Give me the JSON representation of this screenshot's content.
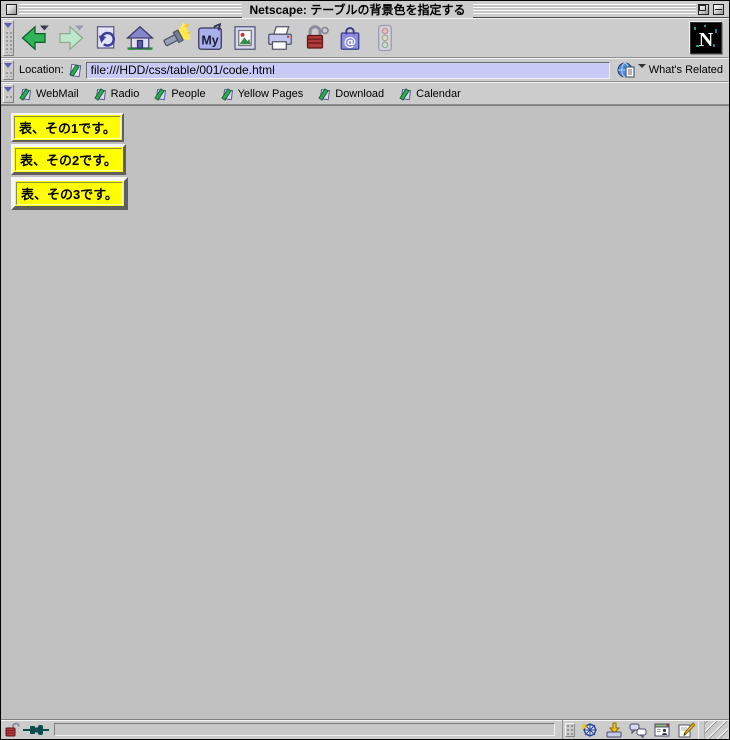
{
  "window": {
    "title": "Netscape: テーブルの背景色を指定する",
    "controls": [
      "close",
      "zoom",
      "collapse"
    ]
  },
  "toolbar": {
    "buttons": [
      {
        "name": "Back",
        "icon": "back-arrow-icon",
        "enabled": true
      },
      {
        "name": "Forward",
        "icon": "forward-arrow-icon",
        "enabled": false
      },
      {
        "name": "Reload",
        "icon": "reload-icon",
        "enabled": true
      },
      {
        "name": "Home",
        "icon": "home-icon",
        "enabled": true
      },
      {
        "name": "Search",
        "icon": "flashlight-icon",
        "enabled": true
      },
      {
        "name": "My Netscape",
        "icon": "my-netscape-icon",
        "enabled": true
      },
      {
        "name": "Images",
        "icon": "images-icon",
        "enabled": true
      },
      {
        "name": "Print",
        "icon": "printer-icon",
        "enabled": true
      },
      {
        "name": "Security",
        "icon": "padlock-icon",
        "enabled": true
      },
      {
        "name": "Shop",
        "icon": "shopping-bag-icon",
        "enabled": true
      },
      {
        "name": "Stop",
        "icon": "traffic-light-icon",
        "enabled": false
      }
    ],
    "throbber": {
      "name": "Netscape N logo",
      "letter": "N"
    }
  },
  "location_bar": {
    "label": "Location:",
    "value": "file:///HDD/css/table/001/code.html",
    "bookmark_icon": "bookmark-icon",
    "whats_related_label": "What's Related",
    "whats_related_icon": "globe-document-icon"
  },
  "personal_toolbar": {
    "items": [
      "WebMail",
      "Radio",
      "People",
      "Yellow Pages",
      "Download",
      "Calendar"
    ],
    "item_icon": "bookmark-ribbon-icon"
  },
  "content": {
    "tables": [
      {
        "text": "表、その1です。",
        "border_px": 1,
        "bgcolor": "#ffff00"
      },
      {
        "text": "表、その2です。",
        "border_px": 2,
        "bgcolor": "#ffff00"
      },
      {
        "text": "表、その3です。",
        "border_px": 3,
        "bgcolor": "#ffff00"
      }
    ]
  },
  "status_bar": {
    "message": "",
    "security_icon": "open-padlock-icon",
    "online_icon": "plug-icon",
    "component_bar": [
      {
        "name": "Navigator",
        "icon": "ship-wheel-icon"
      },
      {
        "name": "Inbox",
        "icon": "inbox-arrow-icon"
      },
      {
        "name": "Discussions",
        "icon": "chat-bubbles-icon"
      },
      {
        "name": "Address Book",
        "icon": "address-book-icon"
      },
      {
        "name": "Composer",
        "icon": "composer-pen-icon"
      }
    ]
  },
  "colors": {
    "platinum": "#cccccc",
    "content_bg": "#c0c0c0",
    "location_field_bg": "#c9c9f6",
    "table_cell_bg": "#ffff00",
    "throbber_bg": "#000000",
    "back_arrow_green": "#2fb457"
  }
}
